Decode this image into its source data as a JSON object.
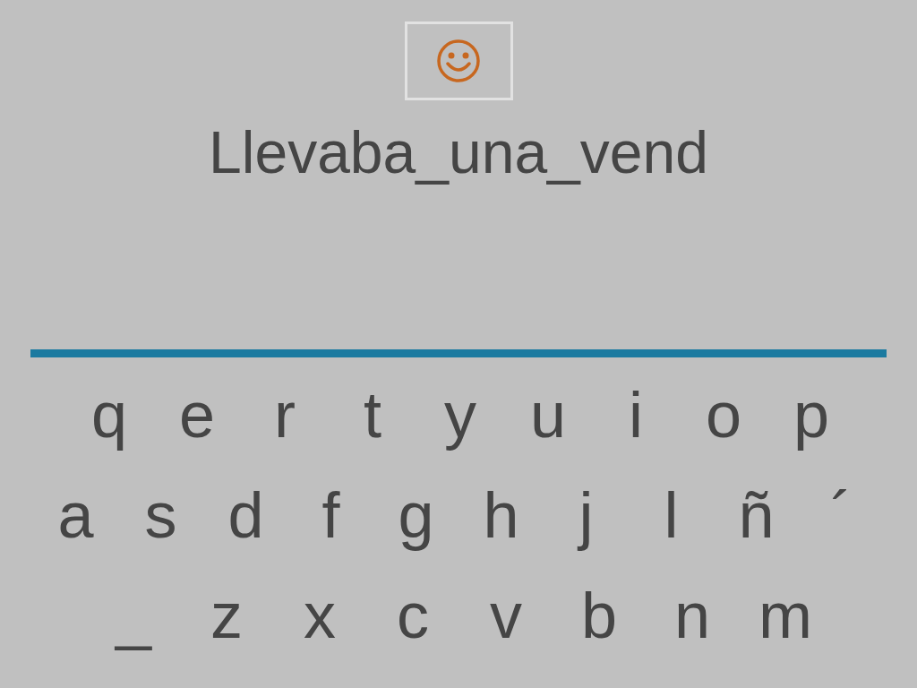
{
  "answer": "Llevaba_una_vend",
  "keyboard": {
    "rows": [
      [
        "q",
        "e",
        "r",
        "t",
        "y",
        "u",
        "i",
        "o",
        "p"
      ],
      [
        "a",
        "s",
        "d",
        "f",
        "g",
        "h",
        "j",
        "l",
        "ñ",
        "´"
      ],
      [
        "_",
        "z",
        "x",
        "c",
        "v",
        "b",
        "n",
        "m"
      ]
    ]
  }
}
